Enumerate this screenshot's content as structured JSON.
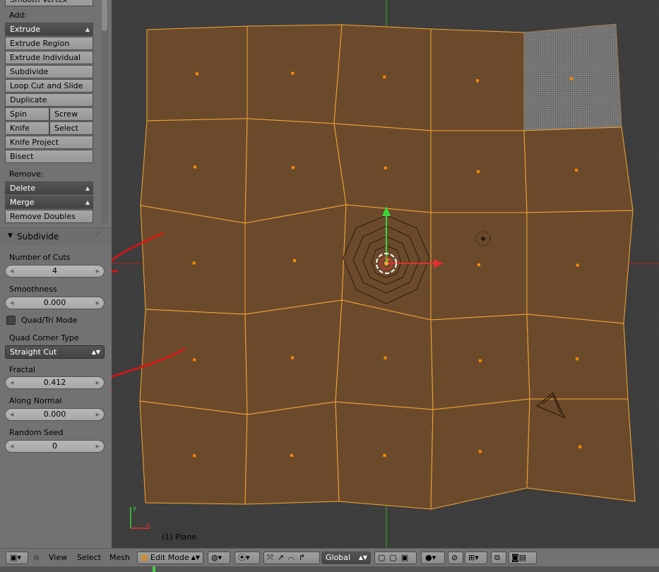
{
  "toolshelf": {
    "top_partial_button": "Smooth Vertex",
    "add_label": "Add:",
    "add_dropdown": "Extrude",
    "add_buttons": [
      "Extrude Region",
      "Extrude Individual",
      "Subdivide",
      "Loop Cut and Slide",
      "Duplicate"
    ],
    "spin": "Spin",
    "screw": "Screw",
    "knife": "Knife",
    "select": "Select",
    "knife_project": "Knife Project",
    "bisect": "Bisect",
    "remove_label": "Remove:",
    "delete_dropdown": "Delete",
    "merge_dropdown": "Merge",
    "remove_doubles": "Remove Doubles"
  },
  "operator_panel": {
    "title": "Subdivide",
    "number_of_cuts_label": "Number of Cuts",
    "number_of_cuts": "4",
    "smoothness_label": "Smoothness",
    "smoothness": "0.000",
    "quad_tri_label": "Quad/Tri Mode",
    "quad_corner_label": "Quad Corner Type",
    "quad_corner_value": "Straight Cut",
    "fractal_label": "Fractal",
    "fractal": "0.412",
    "along_normal_label": "Along Normal",
    "along_normal": "0.000",
    "random_seed_label": "Random Seed",
    "random_seed": "0"
  },
  "viewport": {
    "object_label": "(1) Plane",
    "mesh_color": "#6b4a2c",
    "edge_color": "#f5a733",
    "annotation_color": "#e01010"
  },
  "header": {
    "view": "View",
    "select": "Select",
    "mesh": "Mesh",
    "mode": "Edit Mode",
    "orientation": "Global"
  }
}
